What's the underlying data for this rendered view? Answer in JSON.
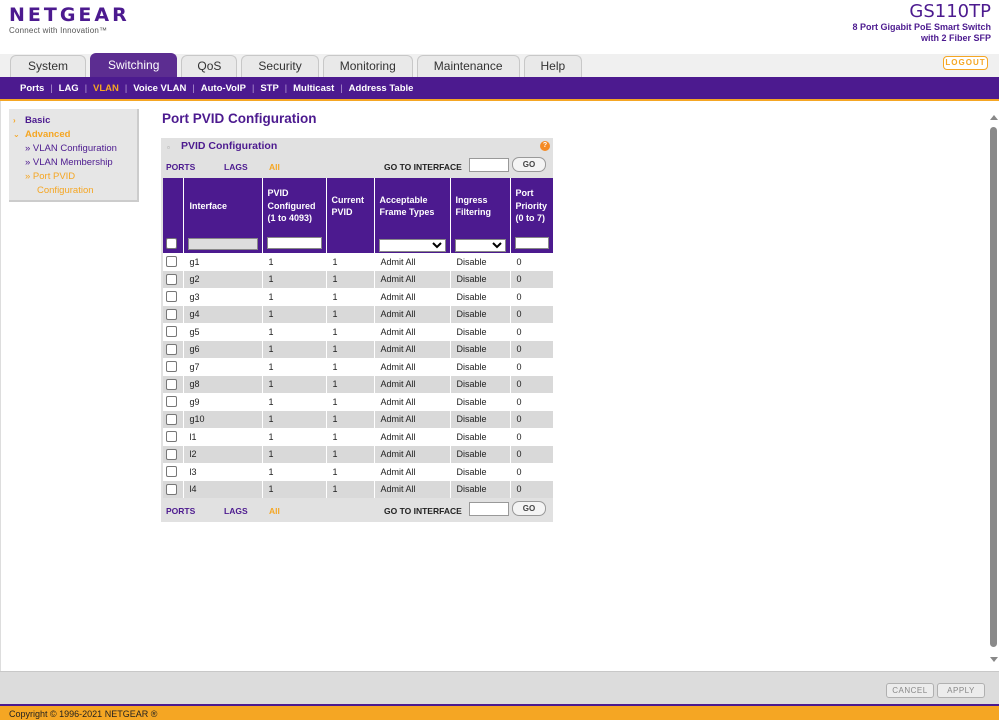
{
  "header": {
    "brand": "NETGEAR",
    "tagline": "Connect with Innovation™",
    "model": "GS110TP",
    "model_desc_1": "8 Port Gigabit PoE Smart Switch",
    "model_desc_2": "with 2 Fiber SFP",
    "logout": "LOGOUT"
  },
  "tabs": [
    "System",
    "Switching",
    "QoS",
    "Security",
    "Monitoring",
    "Maintenance",
    "Help"
  ],
  "active_tab": "Switching",
  "subnav": [
    "Ports",
    "LAG",
    "VLAN",
    "Voice VLAN",
    "Auto-VoIP",
    "STP",
    "Multicast",
    "Address Table"
  ],
  "active_subnav": "VLAN",
  "sidemenu": {
    "basic": "Basic",
    "advanced": "Advanced",
    "items": [
      "» VLAN Configuration",
      "» VLAN Membership",
      "» Port PVID"
    ],
    "continuation": "Configuration"
  },
  "page": {
    "title": "Port PVID Configuration",
    "panel_title": "PVID Configuration",
    "help": "?",
    "filters": {
      "ports": "PORTS",
      "lags": "LAGS",
      "all": "All",
      "goto": "GO TO INTERFACE",
      "go": "GO"
    }
  },
  "table": {
    "headers": [
      "",
      "Interface",
      "PVID Configured (1 to 4093)",
      "Current PVID",
      "Acceptable Frame Types",
      "Ingress Filtering",
      "Port Priority (0 to 7)"
    ],
    "rows": [
      {
        "interface": "g1",
        "pvid": "1",
        "current": "1",
        "frames": "Admit All",
        "ingress": "Disable",
        "priority": "0"
      },
      {
        "interface": "g2",
        "pvid": "1",
        "current": "1",
        "frames": "Admit All",
        "ingress": "Disable",
        "priority": "0"
      },
      {
        "interface": "g3",
        "pvid": "1",
        "current": "1",
        "frames": "Admit All",
        "ingress": "Disable",
        "priority": "0"
      },
      {
        "interface": "g4",
        "pvid": "1",
        "current": "1",
        "frames": "Admit All",
        "ingress": "Disable",
        "priority": "0"
      },
      {
        "interface": "g5",
        "pvid": "1",
        "current": "1",
        "frames": "Admit All",
        "ingress": "Disable",
        "priority": "0"
      },
      {
        "interface": "g6",
        "pvid": "1",
        "current": "1",
        "frames": "Admit All",
        "ingress": "Disable",
        "priority": "0"
      },
      {
        "interface": "g7",
        "pvid": "1",
        "current": "1",
        "frames": "Admit All",
        "ingress": "Disable",
        "priority": "0"
      },
      {
        "interface": "g8",
        "pvid": "1",
        "current": "1",
        "frames": "Admit All",
        "ingress": "Disable",
        "priority": "0"
      },
      {
        "interface": "g9",
        "pvid": "1",
        "current": "1",
        "frames": "Admit All",
        "ingress": "Disable",
        "priority": "0"
      },
      {
        "interface": "g10",
        "pvid": "1",
        "current": "1",
        "frames": "Admit All",
        "ingress": "Disable",
        "priority": "0"
      },
      {
        "interface": "l1",
        "pvid": "1",
        "current": "1",
        "frames": "Admit All",
        "ingress": "Disable",
        "priority": "0"
      },
      {
        "interface": "l2",
        "pvid": "1",
        "current": "1",
        "frames": "Admit All",
        "ingress": "Disable",
        "priority": "0"
      },
      {
        "interface": "l3",
        "pvid": "1",
        "current": "1",
        "frames": "Admit All",
        "ingress": "Disable",
        "priority": "0"
      },
      {
        "interface": "l4",
        "pvid": "1",
        "current": "1",
        "frames": "Admit All",
        "ingress": "Disable",
        "priority": "0"
      }
    ]
  },
  "buttons": {
    "cancel": "CANCEL",
    "apply": "APPLY"
  },
  "footer": "Copyright © 1996-2021 NETGEAR ®",
  "colors": {
    "brand_purple": "#4c1a8f",
    "accent_orange": "#f5a623"
  }
}
